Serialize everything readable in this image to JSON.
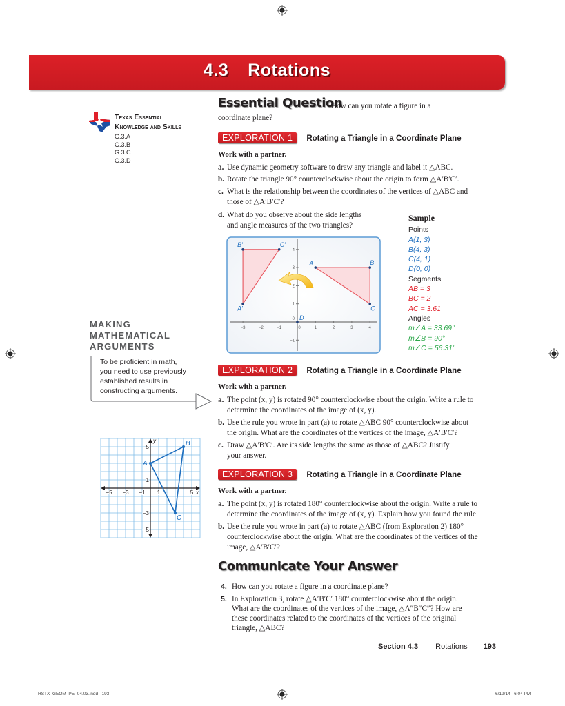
{
  "banner": {
    "section_number": "4.3",
    "title": "Rotations",
    "color": "#d71f26"
  },
  "teks": {
    "title_line1": "Texas Essential",
    "title_line2": "Knowledge and Skills",
    "codes": [
      "G.3.A",
      "G.3.B",
      "G.3.C",
      "G.3.D"
    ],
    "logo_icon": "texas-flag-map-icon"
  },
  "essential_question": {
    "heading": "Essential Question",
    "text_line1": "How can you rotate a figure in a",
    "text_line2": "coordinate plane?"
  },
  "exploration1": {
    "badge": "EXPLORATION 1",
    "title": "Rotating a Triangle in a Coordinate Plane",
    "work": "Work with a partner.",
    "items": [
      {
        "label": "a.",
        "lines": [
          "Use dynamic geometry software to draw any triangle and label it △ABC."
        ]
      },
      {
        "label": "b.",
        "lines": [
          "Rotate the triangle 90° counterclockwise about the origin to form △A′B′C′."
        ]
      },
      {
        "label": "c.",
        "lines": [
          "What is the relationship between the coordinates of the vertices of △ABC and",
          "those of △A′B′C′?"
        ]
      },
      {
        "label": "d.",
        "lines": [
          "What do you observe about the side lengths",
          "and angle measures of the two triangles?"
        ]
      }
    ],
    "graph": {
      "original": {
        "A": [
          1,
          3
        ],
        "B": [
          4,
          3
        ],
        "C": [
          4,
          1
        ]
      },
      "image": {
        "A'": [
          -3,
          1
        ],
        "B'": [
          -3,
          4
        ],
        "C'": [
          -1,
          4
        ]
      },
      "origin_label": "D",
      "x_ticks": [
        "−3",
        "−2",
        "−1",
        "0",
        "1",
        "2",
        "3",
        "4"
      ],
      "y_ticks": [
        "4",
        "3",
        "2",
        "1",
        "0",
        "−1"
      ],
      "labels": {
        "A": "A",
        "B": "B",
        "C": "C",
        "A'": "A′",
        "B'": "B′",
        "C'": "C′"
      }
    },
    "sample": {
      "heading": "Sample",
      "points_label": "Points",
      "points": [
        "A(1, 3)",
        "B(4, 3)",
        "C(4, 1)",
        "D(0, 0)"
      ],
      "segments_label": "Segments",
      "segments": [
        "AB = 3",
        "BC = 2",
        "AC = 3.61"
      ],
      "angles_label": "Angles",
      "angles": [
        "m∠A = 33.69°",
        "m∠B = 90°",
        "m∠C = 56.31°"
      ]
    }
  },
  "making_arguments": {
    "title_lines": [
      "MAKING",
      "MATHEMATICAL",
      "ARGUMENTS"
    ],
    "text_lines": [
      "To be proficient in math,",
      "you need to use previously",
      "established results in",
      "constructing arguments."
    ]
  },
  "exploration2": {
    "badge": "EXPLORATION 2",
    "title": "Rotating a Triangle in a Coordinate Plane",
    "work": "Work with a partner.",
    "items": [
      {
        "label": "a.",
        "lines": [
          "The point (x, y) is rotated 90° counterclockwise about the origin. Write a rule to",
          "determine the coordinates of the image of (x, y)."
        ]
      },
      {
        "label": "b.",
        "lines": [
          "Use the rule you wrote in part (a) to rotate △ABC 90° counterclockwise about",
          "the origin. What are the coordinates of the vertices of the image, △A′B′C′?"
        ]
      },
      {
        "label": "c.",
        "lines": [
          "Draw △A′B′C′. Are its side lengths the same as those of △ABC? Justify",
          "your answer."
        ]
      }
    ],
    "graph": {
      "points": {
        "A": [
          0,
          3
        ],
        "B": [
          4,
          5
        ],
        "C": [
          3,
          -3
        ]
      },
      "x_ticks": [
        "−5",
        "−3",
        "−1",
        "1",
        "5"
      ],
      "y_ticks": [
        "5",
        "1",
        "−3",
        "−5"
      ],
      "x_axis_label": "x",
      "y_axis_label": "y",
      "range": [
        -6,
        6
      ]
    }
  },
  "exploration3": {
    "badge": "EXPLORATION 3",
    "title": "Rotating a Triangle in a Coordinate Plane",
    "work": "Work with a partner.",
    "items": [
      {
        "label": "a.",
        "lines": [
          "The point (x, y) is rotated 180° counterclockwise about the origin. Write a rule to",
          "determine the coordinates of the image of (x, y). Explain how you found the rule."
        ]
      },
      {
        "label": "b.",
        "lines": [
          "Use the rule you wrote in part (a) to rotate △ABC (from Exploration 2) 180°",
          "counterclockwise about the origin. What are the coordinates of the vertices of the",
          "image, △A′B′C′?"
        ]
      }
    ]
  },
  "communicate": {
    "heading": "Communicate Your Answer",
    "items": [
      {
        "label": "4.",
        "lines": [
          "How can you rotate a figure in a coordinate plane?"
        ]
      },
      {
        "label": "5.",
        "lines": [
          "In Exploration 3, rotate △A′B′C′ 180° counterclockwise about the origin.",
          "What are the coordinates of the vertices of the image, △A″B″C″? How are",
          "these coordinates related to the coordinates of the vertices of the original",
          "triangle, △ABC?"
        ]
      }
    ]
  },
  "footer": {
    "section": "Section 4.3",
    "topic": "Rotations",
    "page": "193"
  },
  "slug": {
    "file": "HSTX_GEOM_PE_04.03.indd   193",
    "timestamp": "6/19/14   6:04 PM"
  }
}
